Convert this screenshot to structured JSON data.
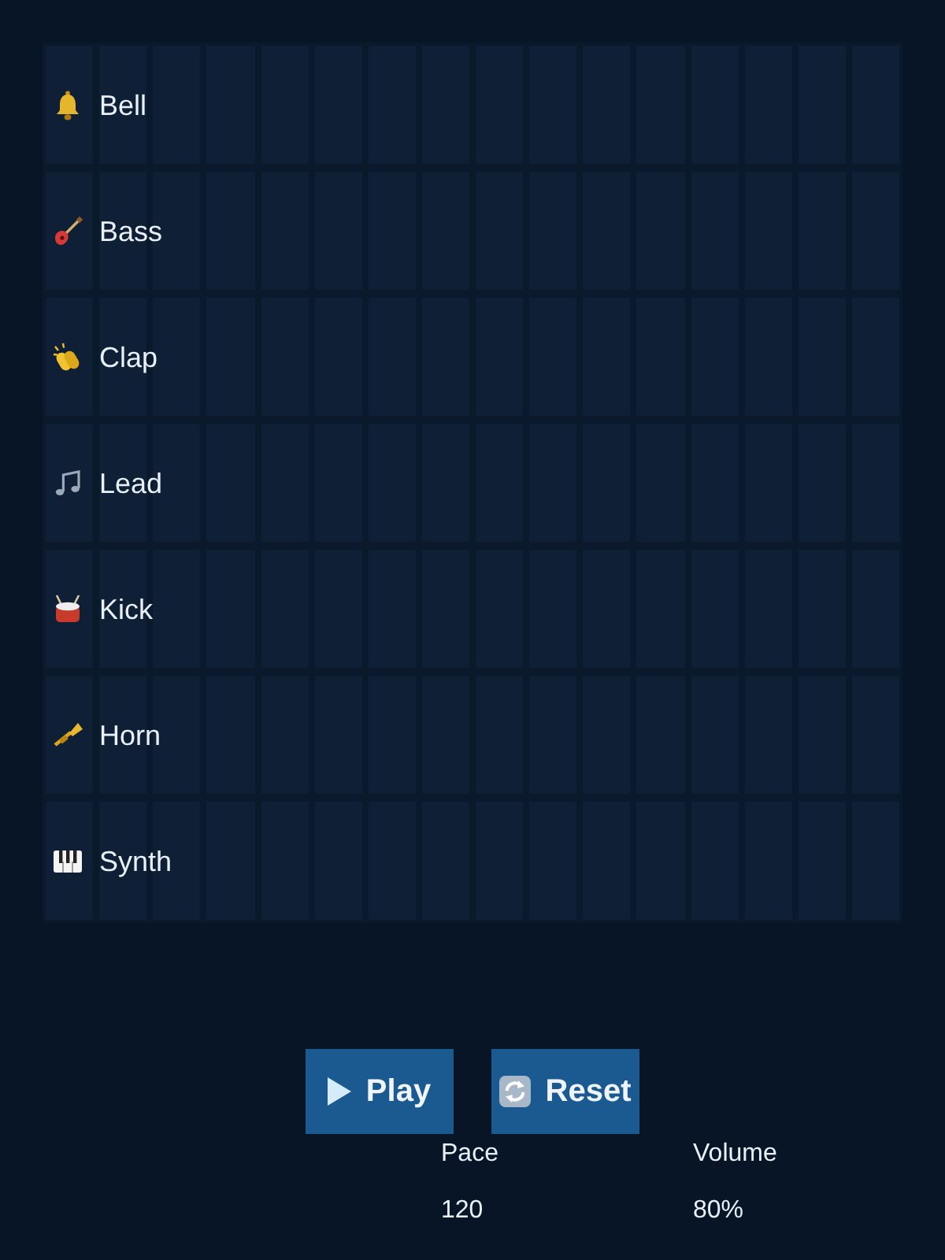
{
  "tracks": [
    {
      "name": "Bell",
      "steps": [
        {
          "on": false
        },
        {
          "on": false
        },
        {
          "on": false
        },
        {
          "on": false
        },
        {
          "on": false
        },
        {
          "on": false
        },
        {
          "on": false
        },
        {
          "on": false
        },
        {
          "on": false
        },
        {
          "on": false
        },
        {
          "on": false
        },
        {
          "on": false
        },
        {
          "on": false
        },
        {
          "on": false
        },
        {
          "on": false
        },
        {
          "on": false
        }
      ]
    },
    {
      "name": "Bass",
      "steps": [
        {
          "on": false
        },
        {
          "on": false
        },
        {
          "on": false
        },
        {
          "on": false
        },
        {
          "on": false
        },
        {
          "on": false
        },
        {
          "on": false
        },
        {
          "on": false
        },
        {
          "on": false
        },
        {
          "on": false
        },
        {
          "on": false
        },
        {
          "on": false
        },
        {
          "on": false
        },
        {
          "on": false
        },
        {
          "on": false
        },
        {
          "on": false
        }
      ]
    },
    {
      "name": "Clap",
      "steps": [
        {
          "on": false
        },
        {
          "on": false
        },
        {
          "on": false
        },
        {
          "on": false
        },
        {
          "on": false
        },
        {
          "on": false
        },
        {
          "on": false
        },
        {
          "on": false
        },
        {
          "on": false
        },
        {
          "on": false
        },
        {
          "on": false
        },
        {
          "on": false
        },
        {
          "on": false
        },
        {
          "on": false
        },
        {
          "on": false
        },
        {
          "on": false
        }
      ]
    },
    {
      "name": "Lead",
      "steps": [
        {
          "on": false
        },
        {
          "on": false
        },
        {
          "on": false
        },
        {
          "on": false
        },
        {
          "on": false
        },
        {
          "on": false
        },
        {
          "on": false
        },
        {
          "on": false
        },
        {
          "on": false
        },
        {
          "on": false
        },
        {
          "on": false
        },
        {
          "on": false
        },
        {
          "on": false
        },
        {
          "on": false
        },
        {
          "on": false
        },
        {
          "on": false
        }
      ]
    },
    {
      "name": "Kick",
      "steps": [
        {
          "on": false
        },
        {
          "on": false
        },
        {
          "on": false
        },
        {
          "on": false
        },
        {
          "on": false
        },
        {
          "on": false
        },
        {
          "on": false
        },
        {
          "on": false
        },
        {
          "on": false
        },
        {
          "on": false
        },
        {
          "on": false
        },
        {
          "on": false
        },
        {
          "on": false
        },
        {
          "on": false
        },
        {
          "on": false
        },
        {
          "on": false
        }
      ]
    },
    {
      "name": "Horn",
      "steps": [
        {
          "on": false
        },
        {
          "on": false
        },
        {
          "on": false
        },
        {
          "on": false
        },
        {
          "on": false
        },
        {
          "on": false
        },
        {
          "on": false
        },
        {
          "on": false
        },
        {
          "on": false
        },
        {
          "on": false
        },
        {
          "on": false
        },
        {
          "on": false
        },
        {
          "on": false
        },
        {
          "on": false
        },
        {
          "on": false
        },
        {
          "on": false
        }
      ]
    },
    {
      "name": "Synth",
      "steps": [
        {
          "on": false
        },
        {
          "on": false
        },
        {
          "on": false
        },
        {
          "on": false
        },
        {
          "on": false
        },
        {
          "on": false
        },
        {
          "on": false
        },
        {
          "on": false
        },
        {
          "on": false
        },
        {
          "on": false
        },
        {
          "on": false
        },
        {
          "on": false
        },
        {
          "on": false
        },
        {
          "on": false
        },
        {
          "on": false
        },
        {
          "on": false
        }
      ]
    }
  ],
  "buttons": [
    {
      "label": "Play",
      "kind": "play"
    },
    {
      "label": "Reset",
      "kind": "reset"
    }
  ],
  "settings": [
    {
      "label": "Pace",
      "value": "120"
    },
    {
      "label": "Volume",
      "value": "80%"
    }
  ]
}
